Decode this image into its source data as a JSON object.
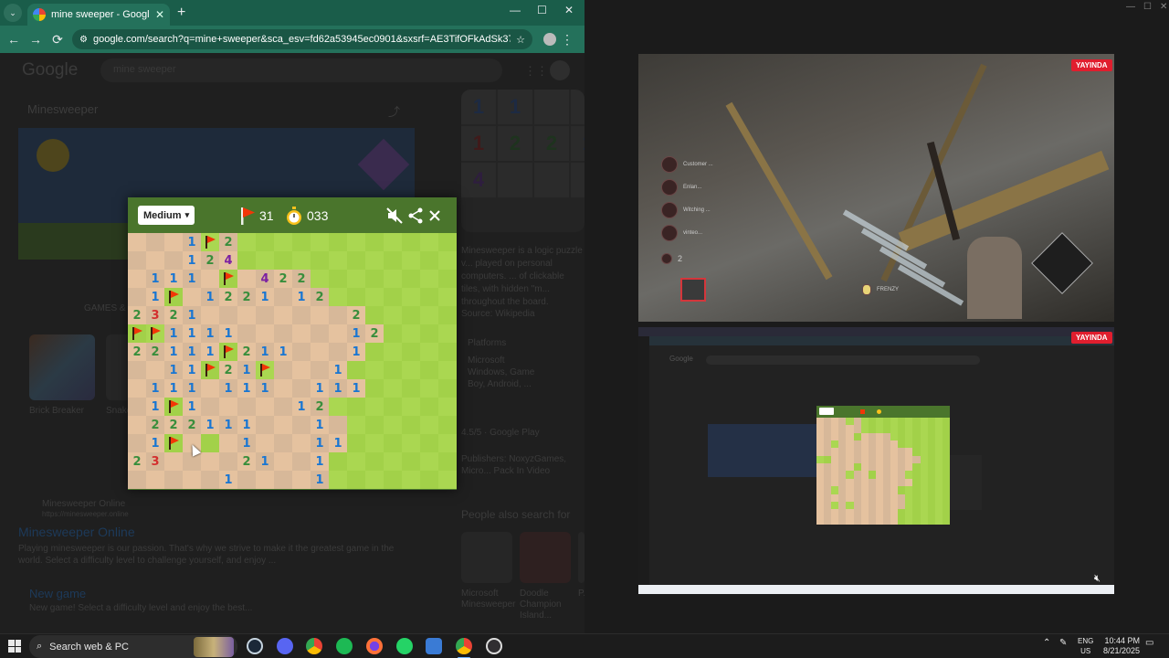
{
  "browser": {
    "tab_title": "mine sweeper - Google Search",
    "tab_close": "✕",
    "new_tab": "+",
    "url": "google.com/search?q=mine+sweeper&sca_esv=fd62a53945ec0901&sxsrf=AE3TifOFkAdSk37_cyq8YlVQFaz...",
    "back": "←",
    "forward": "→",
    "reload": "⟳",
    "bookmark": "☆",
    "menu": "⋮",
    "minimize": "—",
    "maximize": "☐",
    "close": "✕",
    "tab_dropdown": "⌄"
  },
  "google": {
    "logo": "Google",
    "query": "mine sweeper",
    "kp_title": "Minesweeper",
    "games_tab": "GAMES &",
    "side_description": "Minesweeper is a logic puzzle v... played on personal computers. ... of clickable tiles, with hidden \"m... throughout the board.",
    "source": "Source: Wikipedia",
    "platforms_label": "Platforms",
    "platforms_value": "Microsoft Windows, Game Boy, Android, ...",
    "rating": "4.5/5 · Google Play",
    "publishers": "Publishers: NoxyzGames, Micro... Pack In Video",
    "people_also": "People also search for",
    "pas_items": [
      "Microsoft Minesweeper",
      "Doodle Champion Island...",
      "P..."
    ],
    "pas_years": [
      "1990",
      "2021"
    ],
    "result_site": "Minesweeper Online",
    "result_url": "https://minesweeper.online",
    "result_title": "Minesweeper Online",
    "result_snippet": "Playing minesweeper is our passion. That's why we strive to make it the greatest game in the world. Select a difficulty level to challenge yourself, and enjoy ...",
    "result2_title": "New game",
    "result2_snippet": "New game! Select a difficulty level and enjoy the best...",
    "other_games": [
      "Brick Breaker",
      "Snake"
    ],
    "side_thumb_digits": [
      "1",
      "1",
      "",
      "",
      "1",
      "2",
      "2",
      "1",
      "4",
      "",
      "",
      ""
    ]
  },
  "minesweeper": {
    "difficulty": "Medium",
    "dropdown_arrow": "▾",
    "flags_left": "31",
    "timer": "033",
    "colors": {
      "header": "#4a752c",
      "grass_light": "#aad751",
      "grass_dark": "#a2d149",
      "dirt_light": "#e5c29f",
      "dirt_dark": "#d7b899",
      "n1": "#1976d2",
      "n2": "#388e3c",
      "n3": "#d32f2f",
      "n4": "#7b1fa2",
      "flag": "#f23607"
    },
    "legend": "G = covered grass, 0 = opened empty, 1-4 = number, F = flag on grass",
    "board": [
      "0001F2GGGGGGGGGGGG",
      "000124GGGGGGGGGGGG",
      "01110F0422GGGGGGGG",
      "01F01221012GGGGGGG",
      "2321000000002GGGGG",
      "FF111100000012GGGG",
      "22111F2110001GGGGG",
      "0011F21F0001GGGGGG",
      "0111011100111GGGGG",
      "01F10000012GGGGGGG",
      "022211100010GGGGGG",
      "01F0G0100011GGGGGG",
      "23000021001GGGGGGG",
      "00000100001GGGGGGG"
    ]
  },
  "streams": {
    "live_badge": "YAYINDA",
    "hud_names": [
      "Customer ...",
      "Enlan...",
      "Witching ...",
      "vinteo..."
    ],
    "hud_count": "2",
    "hud_friend": "FRENZY"
  },
  "taskbar": {
    "search_placeholder": "Search web & PC",
    "lang_top": "ENG",
    "lang_bottom": "US",
    "time": "10:44 PM",
    "date": "8/21/2025",
    "tray_chevron": "⌃",
    "apps": [
      "Steam",
      "Discord",
      "Chrome",
      "Spotify",
      "Firefox",
      "WhatsApp",
      "Stream Deck",
      "Chrome Active",
      "OBS"
    ]
  }
}
